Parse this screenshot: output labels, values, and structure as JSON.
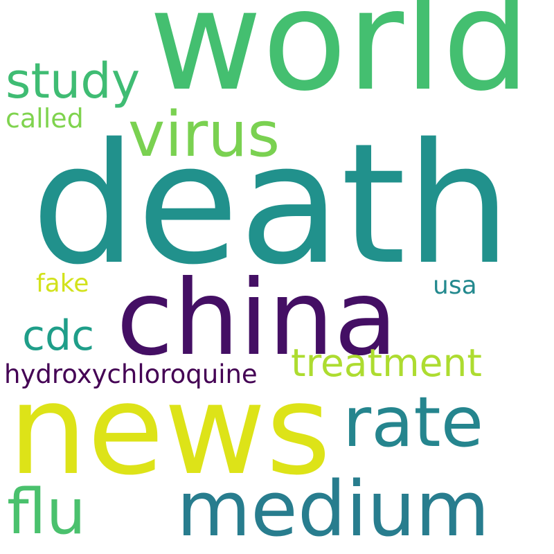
{
  "words": [
    {
      "key": "death",
      "text": "death",
      "color": "#21918c"
    },
    {
      "key": "world",
      "text": "world",
      "color": "#44bf70"
    },
    {
      "key": "news",
      "text": "news",
      "color": "#dde318"
    },
    {
      "key": "china",
      "text": "china",
      "color": "#440f64"
    },
    {
      "key": "medium",
      "text": "medium",
      "color": "#287d8e"
    },
    {
      "key": "rate",
      "text": "rate",
      "color": "#25858e"
    },
    {
      "key": "virus",
      "text": "virus",
      "color": "#7ad151"
    },
    {
      "key": "flu",
      "text": "flu",
      "color": "#4ac16d"
    },
    {
      "key": "study",
      "text": "study",
      "color": "#3fbc73"
    },
    {
      "key": "treatment",
      "text": "treatment",
      "color": "#addc30"
    },
    {
      "key": "cdc",
      "text": "cdc",
      "color": "#1f9e89"
    },
    {
      "key": "hydroxychloroquine",
      "text": "hydroxychloroquine",
      "color": "#440154"
    },
    {
      "key": "called",
      "text": "called",
      "color": "#7fd34e"
    },
    {
      "key": "fake",
      "text": "fake",
      "color": "#d2e21b"
    },
    {
      "key": "usa",
      "text": "usa",
      "color": "#23898e"
    }
  ]
}
